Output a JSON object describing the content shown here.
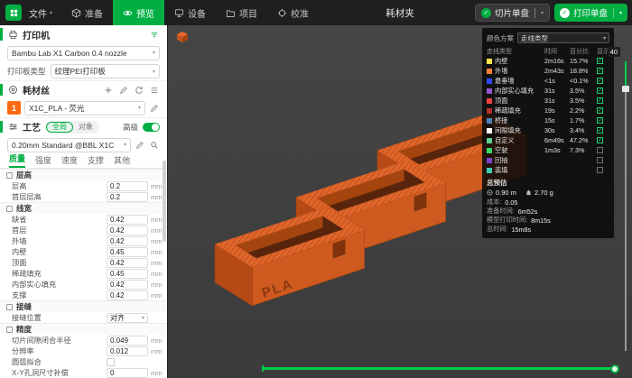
{
  "accent_color": "#00AE42",
  "topbar": {
    "file_menu": "文件",
    "project_title": "耗材夹",
    "tabs": [
      {
        "id": "prepare",
        "label": "准备",
        "active": false
      },
      {
        "id": "preview",
        "label": "预览",
        "active": true
      },
      {
        "id": "device",
        "label": "设备",
        "active": false
      },
      {
        "id": "project",
        "label": "项目",
        "active": false
      },
      {
        "id": "calibration",
        "label": "校准",
        "active": false
      }
    ],
    "slice_button": "切片单盘",
    "print_button": "打印单盘"
  },
  "sidebar": {
    "printer": {
      "title": "打印机",
      "preset": "Bambu Lab X1 Carbon 0.4 nozzle",
      "plate_type_label": "打印板类型",
      "plate_type_value": "纹理PEI打印板"
    },
    "filament": {
      "title": "耗材丝",
      "items": [
        {
          "index": "1",
          "name": "X1C_PLA - 荧光",
          "color": "#FF6A13"
        }
      ]
    },
    "process": {
      "title": "工艺",
      "scope_global": "全局",
      "scope_objects": "对象",
      "advanced_label": "高级",
      "advanced_on": true,
      "preset": "0.20mm Standard @BBL X1C",
      "tabs": [
        {
          "id": "quality",
          "label": "质量",
          "active": true
        },
        {
          "id": "strength",
          "label": "强度",
          "active": false
        },
        {
          "id": "speed",
          "label": "速度",
          "active": false
        },
        {
          "id": "support",
          "label": "支撑",
          "active": false
        },
        {
          "id": "others",
          "label": "其他",
          "active": false
        }
      ],
      "groups": [
        {
          "title": "层高",
          "rows": [
            {
              "label": "层高",
              "value": "0.2",
              "unit": "mm"
            },
            {
              "label": "首层层高",
              "value": "0.2",
              "unit": "mm"
            }
          ]
        },
        {
          "title": "线宽",
          "rows": [
            {
              "label": "缺省",
              "value": "0.42",
              "unit": "mm"
            },
            {
              "label": "首层",
              "value": "0.42",
              "unit": "mm"
            },
            {
              "label": "外墙",
              "value": "0.42",
              "unit": "mm"
            },
            {
              "label": "内壁",
              "value": "0.45",
              "unit": "mm"
            },
            {
              "label": "顶面",
              "value": "0.42",
              "unit": "mm"
            },
            {
              "label": "稀疏填充",
              "value": "0.45",
              "unit": "mm"
            },
            {
              "label": "内部实心填充",
              "value": "0.42",
              "unit": "mm"
            },
            {
              "label": "支撑",
              "value": "0.42",
              "unit": "mm"
            }
          ]
        },
        {
          "title": "接缝",
          "rows": [
            {
              "label": "接缝位置",
              "value": "对齐",
              "unit": "",
              "type": "select"
            }
          ]
        },
        {
          "title": "精度",
          "rows": [
            {
              "label": "切片间隙闭合半径",
              "value": "0.049",
              "unit": "mm"
            },
            {
              "label": "分辨率",
              "value": "0.012",
              "unit": "mm"
            },
            {
              "label": "圆弧拟合",
              "type": "checkbox",
              "checked": false,
              "unit": ""
            },
            {
              "label": "X-Y孔洞尺寸补偿",
              "value": "0",
              "unit": "mm"
            }
          ]
        }
      ]
    }
  },
  "viewport": {
    "model_text": "PLA",
    "layer_value": "40",
    "legend": {
      "title": "颜色方案",
      "scheme_value": "走线类型",
      "columns": [
        "走线类型",
        "时间",
        "百分比",
        "显示"
      ],
      "rows": [
        {
          "label": "内壁",
          "time": "2m16s",
          "percent": "15.7%",
          "color": "#FFE54C",
          "checked": true
        },
        {
          "label": "外墙",
          "time": "2m43s",
          "percent": "18.8%",
          "color": "#FF7D38",
          "checked": true
        },
        {
          "label": "悬垂墙",
          "time": "<1s",
          "percent": "<0.1%",
          "color": "#2F48FF",
          "checked": true
        },
        {
          "label": "内部实心填充",
          "time": "31s",
          "percent": "3.5%",
          "color": "#9654CC",
          "checked": true
        },
        {
          "label": "顶面",
          "time": "31s",
          "percent": "3.5%",
          "color": "#F04040",
          "checked": true
        },
        {
          "label": "稀疏填充",
          "time": "19s",
          "percent": "2.2%",
          "color": "#B0302A",
          "checked": true
        },
        {
          "label": "桥接",
          "time": "15s",
          "percent": "1.7%",
          "color": "#4C83BA",
          "checked": true
        },
        {
          "label": "间隙填充",
          "time": "30s",
          "percent": "3.4%",
          "color": "#FFFFFF",
          "checked": true
        },
        {
          "label": "自定义",
          "time": "6m49s",
          "percent": "47.2%",
          "color": "#5ED194",
          "checked": true
        },
        {
          "label": "空驶",
          "time": "1m3s",
          "percent": "7.3%",
          "color": "#3ADA66",
          "checked": false
        },
        {
          "label": "回抽",
          "time": "",
          "percent": "",
          "color": "#803ECC",
          "checked": false
        },
        {
          "label": "装填",
          "time": "",
          "percent": "",
          "color": "#3ECCB4",
          "checked": false
        }
      ],
      "totals": {
        "title": "总预估",
        "filament_length": "0.90 m",
        "filament_weight": "2.70 g",
        "rows": [
          {
            "label": "成本",
            "value": "0.05"
          },
          {
            "label": "准备时间",
            "value": "6m52s"
          },
          {
            "label": "模型打印时间",
            "value": "8m15s"
          },
          {
            "label": "总时间",
            "value": "15m8s"
          }
        ]
      }
    }
  }
}
